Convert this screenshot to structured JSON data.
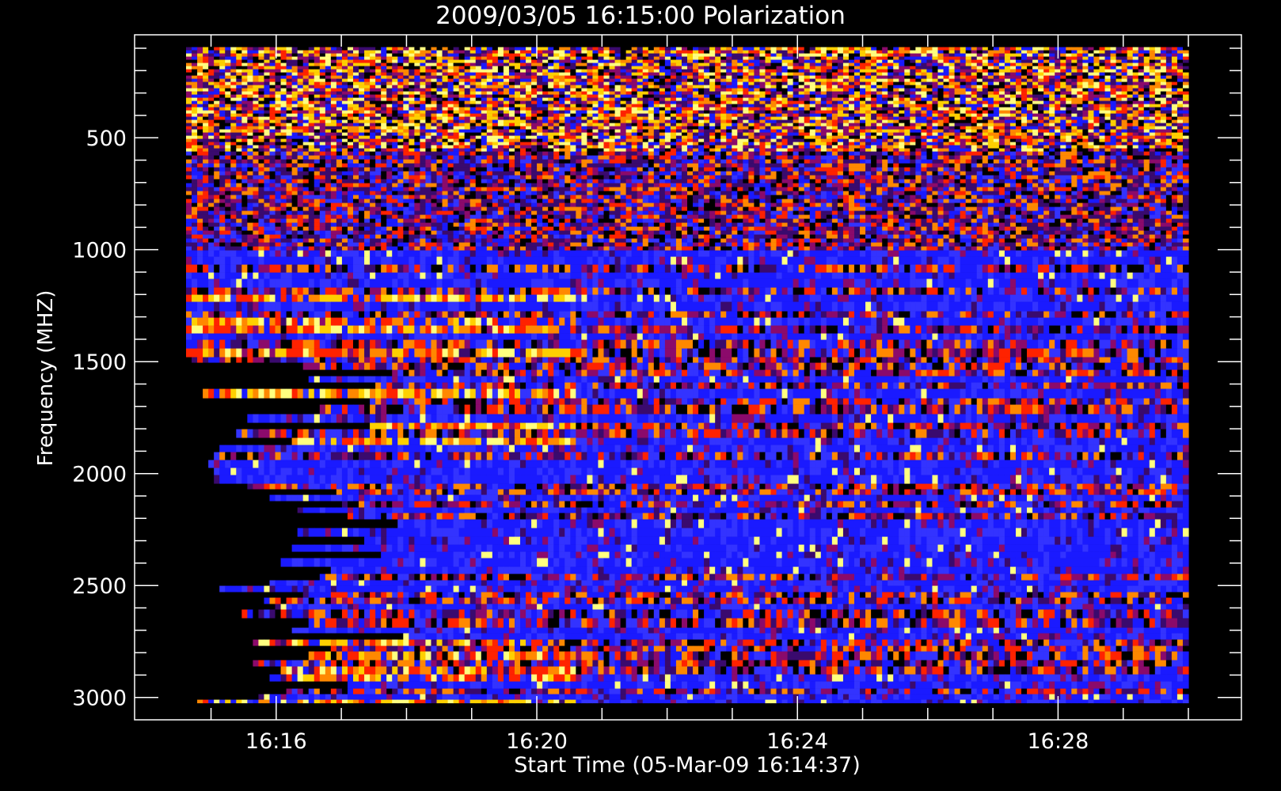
{
  "chart_data": {
    "type": "heatmap",
    "title": "2009/03/05 16:15:00 Polarization",
    "xlabel": "Start Time (05-Mar-09 16:14:37)",
    "ylabel": "Frequency (MHZ)",
    "x_range_minutes": [
      "16:14:37",
      "16:30:00"
    ],
    "y_range_mhz": [
      3100,
      40
    ],
    "y_inverted": true,
    "x_ticks": [
      "16:16",
      "16:20",
      "16:24",
      "16:28"
    ],
    "y_ticks": [
      "500",
      "1000",
      "1500",
      "2000",
      "2500",
      "3000"
    ],
    "colormap": [
      "#000000",
      "#3a0a6e",
      "#1a1aff",
      "#3333ff",
      "#8b0a6b",
      "#ff2200",
      "#ff8800",
      "#ffd000",
      "#ffff80"
    ],
    "colors": {
      "background": "#000000",
      "frame": "#ffffff"
    }
  }
}
